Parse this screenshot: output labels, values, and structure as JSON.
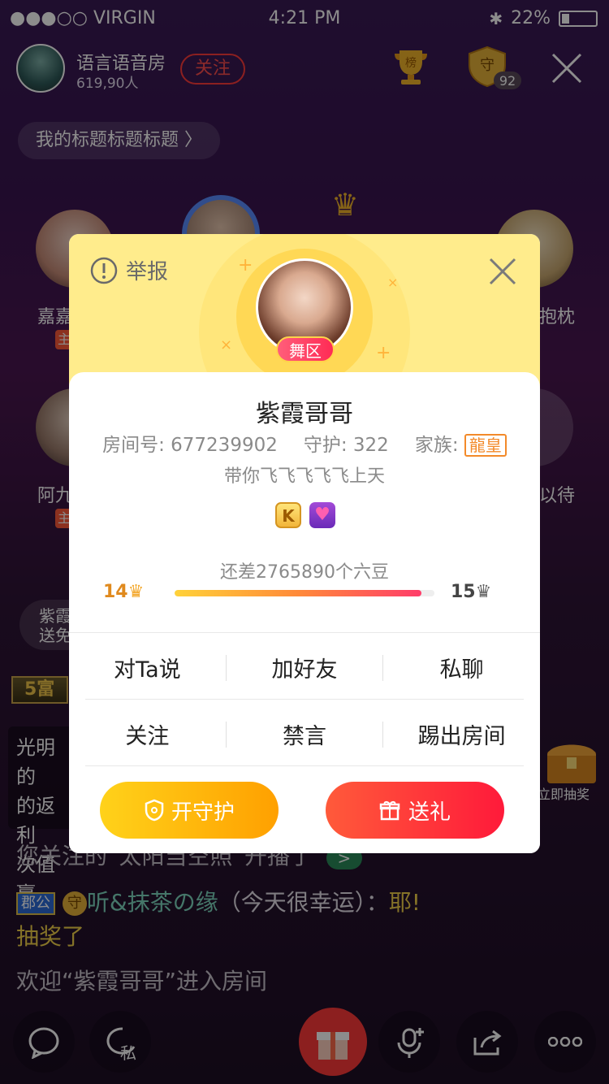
{
  "status_bar": {
    "carrier": "●●●○○ VIRGIN",
    "time": "4:21 PM",
    "battery": "22%"
  },
  "room": {
    "name": "语言语音房",
    "count": "619,90人",
    "follow_label": "关注",
    "rank_label": "榜",
    "guard_label": "守",
    "guard_count": "92",
    "title": "我的标题标题标题"
  },
  "seats": {
    "labels": [
      "嘉嘉",
      "抱枕",
      "阿九",
      "以待"
    ],
    "host_tag": "主"
  },
  "left_peek": {
    "line1": "紫霞",
    "line2": "送免"
  },
  "chat": {
    "level_badge": "5富",
    "msg1": [
      "光明的",
      "的返利",
      "次值赢"
    ],
    "msg2": "您关注的“太阳当空照”开播了",
    "msg3_badge": "郡公",
    "msg3_guard": "守",
    "msg3_user": "听&抹茶の缘",
    "msg3_mid": "（今天很幸运）：",
    "msg3_tail": "耶!",
    "msg3_line2": "抽奖了",
    "msg4": "欢迎“紫霞哥哥”进入房间"
  },
  "lottery": {
    "label": "立即抽奖"
  },
  "bottom_bar": {
    "private_label": "私"
  },
  "modal": {
    "report_label": "举报",
    "dance_badge": "舞区",
    "nickname": "紫霞哥哥",
    "room_no": "房间号: 677239902",
    "guard": "守护: 322",
    "family_label": "家族:",
    "family_tag": "龍皇",
    "slogan": "带你飞飞飞飞飞上天",
    "badge_k": "K",
    "remain": "还差2765890个六豆",
    "level_current": "14",
    "level_next": "15",
    "progress": 0.95,
    "actions_row1": [
      "对Ta说",
      "加好友",
      "私聊"
    ],
    "actions_row2": [
      "关注",
      "禁言",
      "踢出房间"
    ],
    "guard_button": "开守护",
    "gift_button": "送礼"
  },
  "colors": {
    "accent_orange": "#ffa000",
    "accent_red": "#ff1a3a",
    "modal_top": "#ffec8c",
    "follow_red": "#ff3b3b"
  }
}
